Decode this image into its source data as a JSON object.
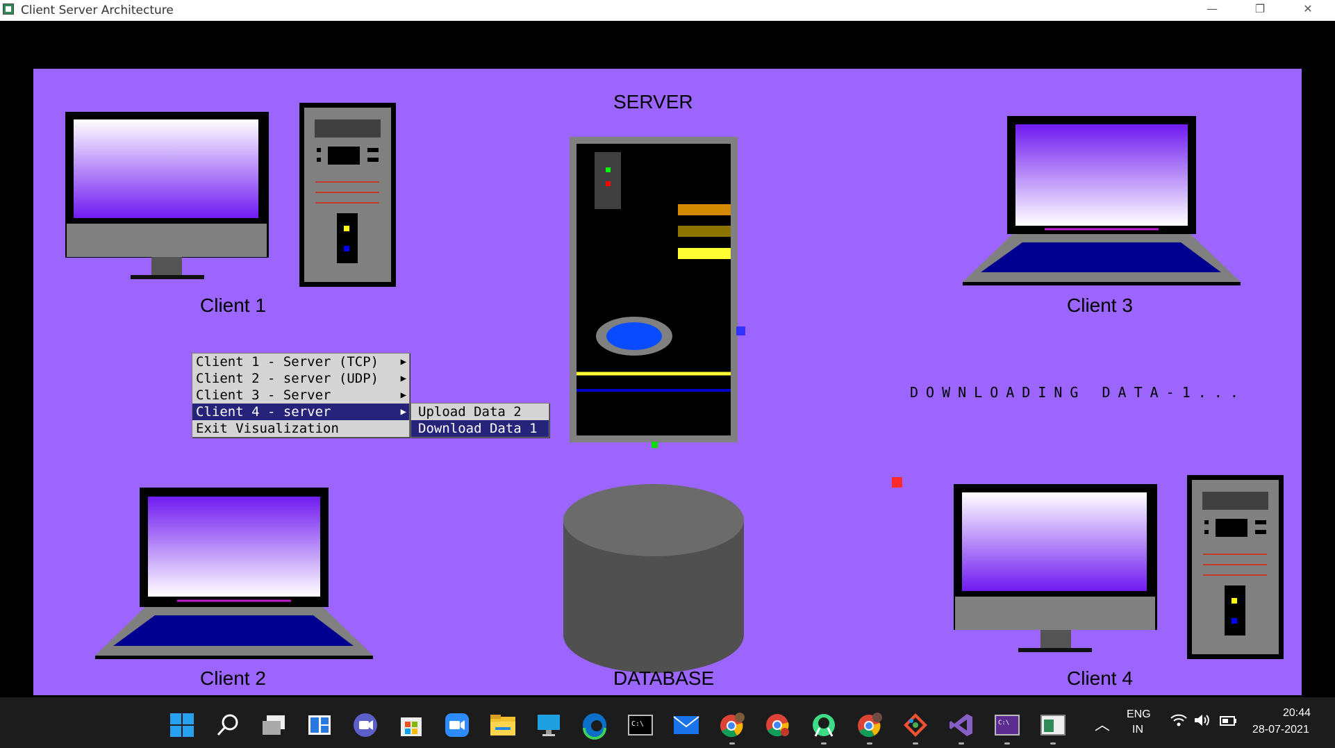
{
  "window": {
    "title": "Client Server Architecture",
    "minimize": "—",
    "restore": "❐",
    "close": "✕"
  },
  "scene": {
    "server_label": "SERVER",
    "database_label": "DATABASE",
    "client1_label": "Client 1",
    "client2_label": "Client 2",
    "client3_label": "Client 3",
    "client4_label": "Client 4",
    "status_text": "DOWNLOADING DATA-1...",
    "background_color": "#9b65fe"
  },
  "menu": {
    "items": [
      {
        "label": "Client 1 - Server (TCP)",
        "has_submenu": true
      },
      {
        "label": "Client 2 - server (UDP)",
        "has_submenu": true
      },
      {
        "label": "Client 3 - Server",
        "has_submenu": true
      },
      {
        "label": "Client 4 - server",
        "has_submenu": true,
        "selected": true
      },
      {
        "label": "Exit Visualization",
        "has_submenu": false
      }
    ],
    "submenu": [
      {
        "label": "Upload Data 2"
      },
      {
        "label": "Download Data 1",
        "selected": true
      }
    ],
    "selected_color": "#25247a"
  },
  "taskbar": {
    "icons": [
      "windows-start-icon",
      "search-icon",
      "task-view-icon",
      "widgets-icon",
      "chat-icon",
      "store-icon",
      "zoom-icon",
      "file-explorer-icon",
      "remote-desktop-icon",
      "edge-icon",
      "terminal-icon",
      "mail-icon",
      "chrome-profile-icon",
      "chrome-icon",
      "android-studio-icon",
      "chrome-alt-icon",
      "git-icon",
      "visual-studio-icon",
      "console-icon",
      "app-window-icon"
    ],
    "language": "ENG",
    "region": "IN",
    "time": "20:44",
    "date": "28-07-2021"
  }
}
